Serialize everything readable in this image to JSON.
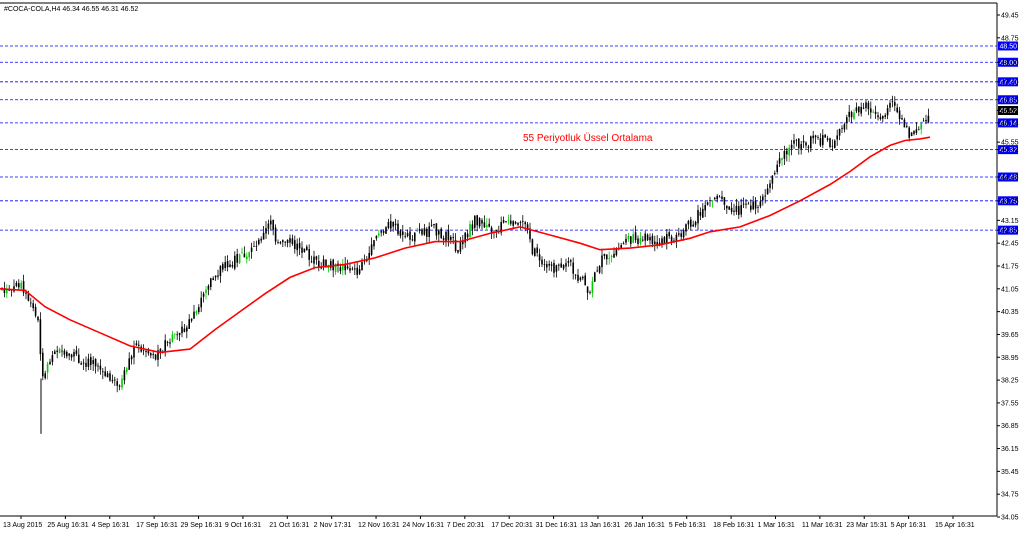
{
  "chart_data": {
    "type": "candlestick",
    "header": "#COCA-COLA,H4  46.34 46.55 46.31 46.52",
    "symbol": "#COCA-COLA,H4",
    "ohlc_header": [
      "46.34",
      "46.55",
      "46.31",
      "46.52"
    ],
    "ylim": [
      34.05,
      49.8
    ],
    "y_ticks": [
      "49.45",
      "48.75",
      "48.00",
      "47.40",
      "46.85",
      "46.52",
      "46.14",
      "45.55",
      "45.32",
      "44.48",
      "43.75",
      "43.15",
      "42.85",
      "42.45",
      "41.75",
      "41.05",
      "40.35",
      "39.65",
      "38.95",
      "38.25",
      "37.55",
      "36.85",
      "36.15",
      "35.45",
      "34.75",
      "34.05"
    ],
    "x_ticks": [
      "13 Aug 2015",
      "25 Aug 16:31",
      "4 Sep 16:31",
      "17 Sep 16:31",
      "29 Sep 16:31",
      "9 Oct 16:31",
      "21 Oct 16:31",
      "2 Nov 17:31",
      "12 Nov 16:31",
      "24 Nov 16:31",
      "7 Dec 20:31",
      "17 Dec 20:31",
      "31 Dec 16:31",
      "13 Jan 16:31",
      "26 Jan 16:31",
      "5 Feb 16:31",
      "18 Feb 16:31",
      "1 Mar 16:31",
      "11 Mar 16:31",
      "23 Mar 15:31",
      "5 Apr 16:31",
      "15 Apr 16:31"
    ],
    "horizontal_levels": [
      "48.50",
      "48.00",
      "47.40",
      "46.85",
      "46.14",
      "45.32",
      "44.48",
      "43.75",
      "42.85"
    ],
    "current_price": "46.52",
    "ema_label": "55 Periyotluk Üssel Ortalama",
    "ema_points": [
      [
        0,
        41.05
      ],
      [
        25,
        41.0
      ],
      [
        45,
        40.5
      ],
      [
        70,
        40.1
      ],
      [
        100,
        39.7
      ],
      [
        130,
        39.3
      ],
      [
        160,
        39.1
      ],
      [
        190,
        39.2
      ],
      [
        215,
        39.8
      ],
      [
        240,
        40.35
      ],
      [
        265,
        40.9
      ],
      [
        290,
        41.4
      ],
      [
        315,
        41.7
      ],
      [
        345,
        41.8
      ],
      [
        375,
        42.0
      ],
      [
        405,
        42.3
      ],
      [
        435,
        42.5
      ],
      [
        460,
        42.5
      ],
      [
        490,
        42.75
      ],
      [
        520,
        42.95
      ],
      [
        550,
        42.7
      ],
      [
        580,
        42.45
      ],
      [
        600,
        42.25
      ],
      [
        630,
        42.3
      ],
      [
        660,
        42.4
      ],
      [
        690,
        42.6
      ],
      [
        710,
        42.8
      ],
      [
        740,
        42.95
      ],
      [
        770,
        43.3
      ],
      [
        800,
        43.75
      ],
      [
        830,
        44.25
      ],
      [
        850,
        44.65
      ],
      [
        870,
        45.1
      ],
      [
        890,
        45.45
      ],
      [
        905,
        45.6
      ],
      [
        920,
        45.65
      ],
      [
        930,
        45.7
      ]
    ],
    "colors": {
      "ema": "#ff0000",
      "levels": "#0000ff",
      "label_box": "#0000ff",
      "bear_candle": "#000000",
      "bull_candle": "#00cc00",
      "annotation": "#ff0000"
    },
    "grid": false
  }
}
